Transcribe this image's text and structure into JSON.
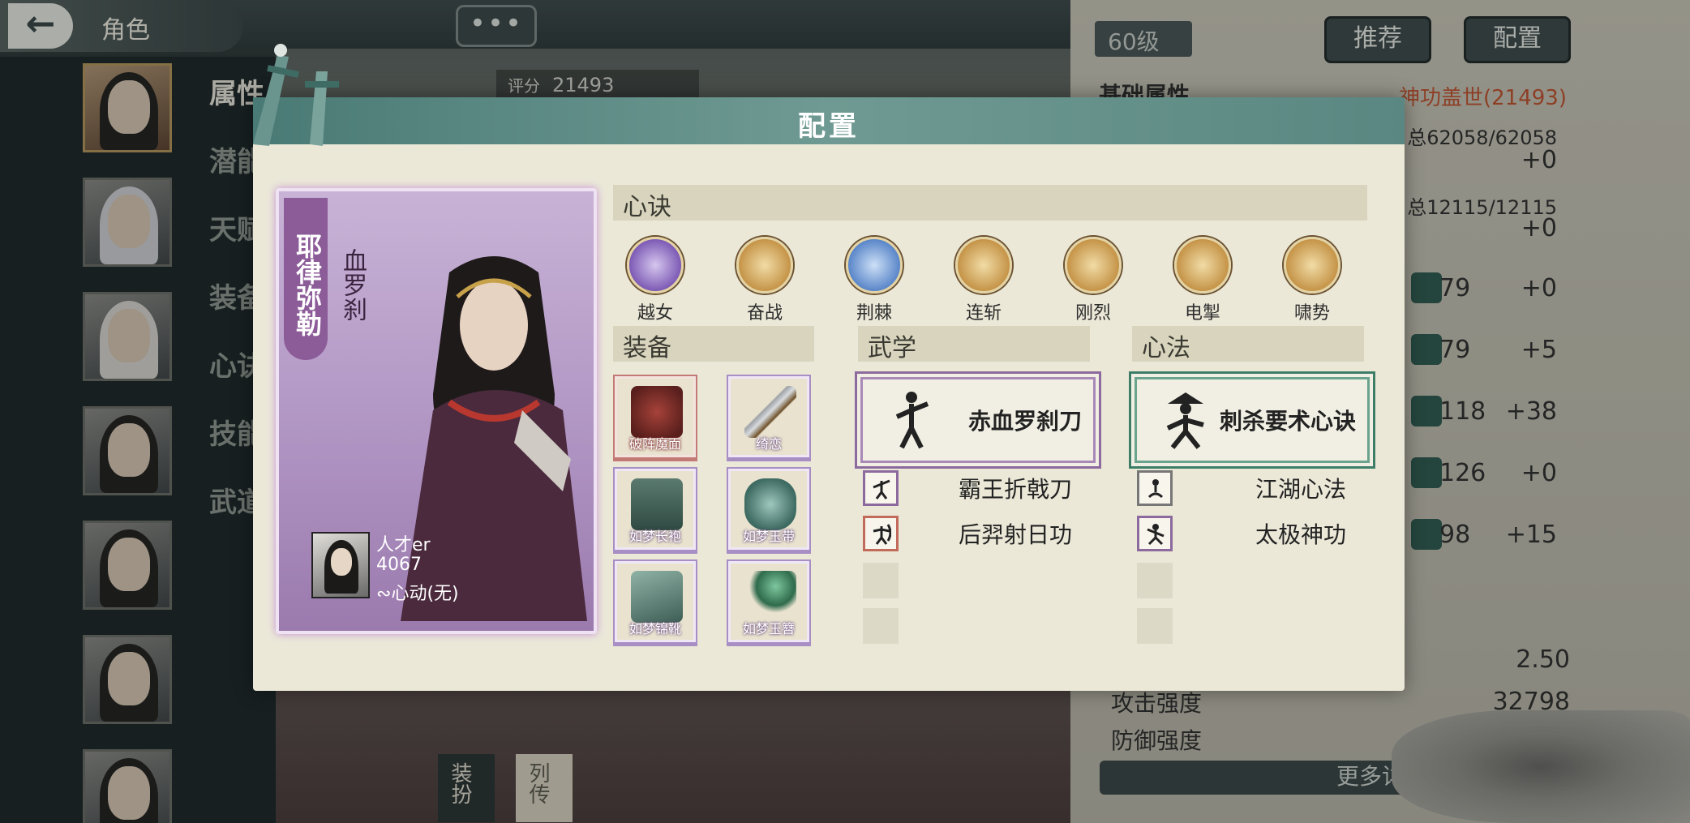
{
  "header": {
    "title": "角色",
    "chat_icon": "ellipsis-icon"
  },
  "sidebar": {
    "menu": [
      "属性",
      "潜能",
      "天赋",
      "装备",
      "心诀",
      "技能",
      "武道"
    ]
  },
  "score": {
    "label": "评分",
    "value": "21493"
  },
  "level": "60级",
  "buttons": {
    "recommend": "推荐",
    "config": "配置"
  },
  "attributes": {
    "title": "基础属性",
    "power_text": "神功盖世(21493)",
    "hp": "总62058/62058",
    "hp_bonus": "+0",
    "mp": "总12115/12115",
    "mp_bonus": "+0",
    "stats": [
      {
        "icon_label": "内",
        "value": "79",
        "bonus": "+0"
      },
      {
        "icon_label": "内",
        "value": "79",
        "bonus": "+5"
      },
      {
        "icon_label": "乙",
        "value": "118",
        "bonus": "+38"
      },
      {
        "icon_label": "乙",
        "value": "126",
        "bonus": "+0"
      },
      {
        "icon_label": "乙",
        "value": "98",
        "bonus": "+15"
      }
    ],
    "rate_value": "2.50",
    "attack_label": "攻击强度",
    "attack_value": "32798",
    "defense_label": "防御强度",
    "more": "更多详情"
  },
  "bottom_buttons": {
    "dress": "装扮",
    "biography": "列传"
  },
  "modal": {
    "title": "配置",
    "character": {
      "name": "耶律弥勒",
      "title": "血罗刹",
      "player_name": "人才er",
      "player_score": "4067",
      "heart": "心动(无)"
    },
    "sections": {
      "xinjue": "心诀",
      "equipment": "装备",
      "wuxue": "武学",
      "xinfa": "心法"
    },
    "skills": [
      "越女",
      "奋战",
      "荆棘",
      "连斩",
      "刚烈",
      "电掣",
      "啸势"
    ],
    "skill_colors": [
      "#7d5bb5",
      "#c59448",
      "#5a86c9",
      "#c59448",
      "#c59448",
      "#c59448",
      "#c59448"
    ],
    "equipment": [
      "破阵魔面",
      "绮恋",
      "如梦长袍",
      "如梦玉带",
      "如梦锦靴",
      "如梦玉簪"
    ],
    "wuxue": {
      "main": "赤血罗刹刀",
      "subs": [
        "霸王折戟刀",
        "后羿射日功"
      ]
    },
    "xinfa": {
      "main": "刺杀要术心诀",
      "subs": [
        "江湖心法",
        "太极神功"
      ]
    }
  }
}
